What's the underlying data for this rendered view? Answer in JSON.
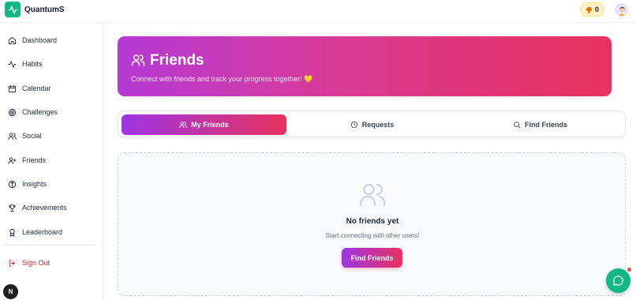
{
  "app": {
    "name": "QuantumS"
  },
  "header": {
    "points": "0",
    "trophy_icon": "trophy-icon",
    "accent": "#10b981"
  },
  "sidebar": {
    "items": [
      {
        "label": "Dashboard",
        "icon": "home-icon"
      },
      {
        "label": "Habits",
        "icon": "activity-icon"
      },
      {
        "label": "Calendar",
        "icon": "calendar-icon"
      },
      {
        "label": "Challenges",
        "icon": "target-icon"
      },
      {
        "label": "Social",
        "icon": "users-icon"
      },
      {
        "label": "Friends",
        "icon": "user-plus-icon"
      },
      {
        "label": "Insights",
        "icon": "compass-icon"
      },
      {
        "label": "Achievements",
        "icon": "trophy-icon"
      },
      {
        "label": "Leaderboard",
        "icon": "award-icon"
      }
    ],
    "signout": "Sign Out",
    "badge": "N"
  },
  "hero": {
    "title": "Friends",
    "subtitle": "Connect with friends and track your progress together! 💛"
  },
  "tabs": [
    {
      "label": "My Friends",
      "icon": "users-icon",
      "active": true
    },
    {
      "label": "Requests",
      "icon": "clock-icon",
      "active": false
    },
    {
      "label": "Find Friends",
      "icon": "search-icon",
      "active": false
    }
  ],
  "empty": {
    "title": "No friends yet",
    "subtitle": "Start connecting with other users!",
    "button": "Find Friends"
  }
}
